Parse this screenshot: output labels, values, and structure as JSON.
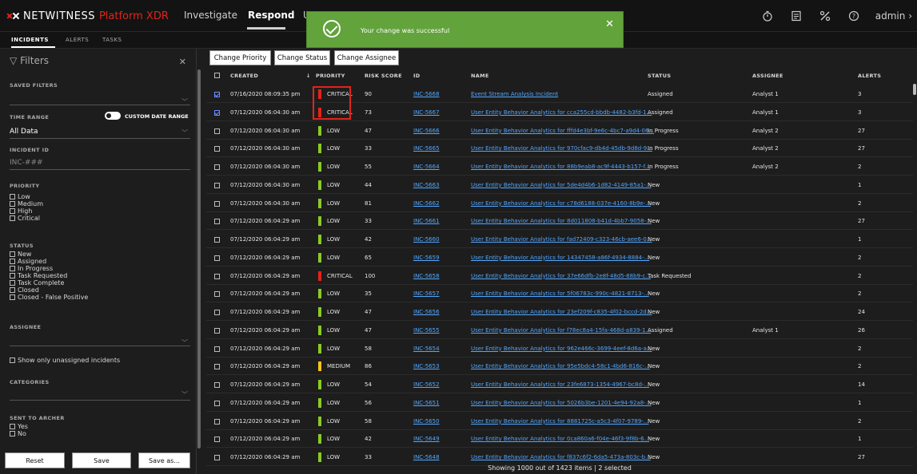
{
  "app": {
    "brand": "NETWITNESS",
    "product": "Platform XDR",
    "nav": [
      {
        "label": "Investigate"
      },
      {
        "label": "Respond"
      },
      {
        "label": "U"
      }
    ],
    "user": "admin",
    "icons": [
      "timer-icon",
      "report-icon",
      "tools-icon",
      "help-icon"
    ]
  },
  "toast": {
    "message": "Your change was successful"
  },
  "subtabs": [
    "INCIDENTS",
    "ALERTS",
    "TASKS"
  ],
  "sidebar": {
    "title": "Filters",
    "saved_filters_label": "SAVED FILTERS",
    "time_range_label": "TIME RANGE",
    "custom_date_range_label": "CUSTOM DATE RANGE",
    "time_range_value": "All Data",
    "incident_id_label": "INCIDENT ID",
    "incident_id_placeholder": "INC-###",
    "priority_label": "PRIORITY",
    "priority_options": [
      "Low",
      "Medium",
      "High",
      "Critical"
    ],
    "status_label": "STATUS",
    "status_options": [
      "New",
      "Assigned",
      "In Progress",
      "Task Requested",
      "Task Complete",
      "Closed",
      "Closed - False Positive"
    ],
    "assignee_label": "ASSIGNEE",
    "unassigned_label": "Show only unassigned incidents",
    "categories_label": "CATEGORIES",
    "archer_label": "SENT TO ARCHER",
    "archer_options": [
      "Yes",
      "No"
    ],
    "buttons": {
      "reset": "Reset",
      "save": "Save",
      "save_as": "Save as..."
    }
  },
  "toolbar": {
    "change_priority": "Change Priority",
    "change_status": "Change Status",
    "change_assignee": "Change Assignee"
  },
  "columns": {
    "created": "CREATED",
    "priority": "PRIORITY",
    "risk_score": "RISK SCORE",
    "id": "ID",
    "name": "NAME",
    "status": "STATUS",
    "assignee": "ASSIGNEE",
    "alerts": "ALERTS",
    "sort_indicator": "↓"
  },
  "priority_colors": {
    "CRITICAL": "#e2241b",
    "LOW": "#8ac926",
    "MEDIUM": "#f5c518"
  },
  "rows": [
    {
      "checked": true,
      "created": "07/16/2020 08:09:35 pm",
      "priority": "CRITICAL",
      "risk": "90",
      "id": "INC-5668",
      "name": "Event Stream Analysis Incident",
      "status": "Assigned",
      "assignee": "Analyst 1",
      "alerts": "3"
    },
    {
      "checked": true,
      "created": "07/12/2020 06:04:30 am",
      "priority": "CRITICAL",
      "risk": "73",
      "id": "INC-5667",
      "name": "User Entity Behavior Analytics for cca255cd-bbdb-4482-b3fd-1...",
      "status": "Assigned",
      "assignee": "Analyst 1",
      "alerts": "3"
    },
    {
      "checked": false,
      "created": "07/12/2020 06:04:30 am",
      "priority": "LOW",
      "risk": "47",
      "id": "INC-5666",
      "name": "User Entity Behavior Analytics for fffd4e3bf-9e6c-4bc7-a9d4-06...",
      "status": "In Progress",
      "assignee": "Analyst 2",
      "alerts": "27"
    },
    {
      "checked": false,
      "created": "07/12/2020 06:04:30 am",
      "priority": "LOW",
      "risk": "33",
      "id": "INC-5665",
      "name": "User Entity Behavior Analytics for 970cfac9-db4d-45db-9d8d-9...",
      "status": "In Progress",
      "assignee": "Analyst 2",
      "alerts": "27"
    },
    {
      "checked": false,
      "created": "07/12/2020 06:04:30 am",
      "priority": "LOW",
      "risk": "55",
      "id": "INC-5664",
      "name": "User Entity Behavior Analytics for 88b9eab8-ac9f-4443-b157-f...",
      "status": "In Progress",
      "assignee": "Analyst 2",
      "alerts": "2"
    },
    {
      "checked": false,
      "created": "07/12/2020 06:04:30 am",
      "priority": "LOW",
      "risk": "44",
      "id": "INC-5663",
      "name": "User Entity Behavior Analytics for 5de4d4b6-1d82-4149-85a1-...",
      "status": "New",
      "assignee": "",
      "alerts": "1"
    },
    {
      "checked": false,
      "created": "07/12/2020 06:04:30 am",
      "priority": "LOW",
      "risk": "81",
      "id": "INC-5662",
      "name": "User Entity Behavior Analytics for c78d6188-037e-4160-8b9e-...",
      "status": "New",
      "assignee": "",
      "alerts": "2"
    },
    {
      "checked": false,
      "created": "07/12/2020 06:04:29 am",
      "priority": "LOW",
      "risk": "33",
      "id": "INC-5661",
      "name": "User Entity Behavior Analytics for 8d011808-b41d-4bb7-9058-...",
      "status": "New",
      "assignee": "",
      "alerts": "27"
    },
    {
      "checked": false,
      "created": "07/12/2020 06:04:29 am",
      "priority": "LOW",
      "risk": "42",
      "id": "INC-5660",
      "name": "User Entity Behavior Analytics for fad72409-c323-46cb-aee6-0...",
      "status": "New",
      "assignee": "",
      "alerts": "1"
    },
    {
      "checked": false,
      "created": "07/12/2020 06:04:29 am",
      "priority": "LOW",
      "risk": "65",
      "id": "INC-5659",
      "name": "User Entity Behavior Analytics for 14347458-a86f-4934-8884-...",
      "status": "New",
      "assignee": "",
      "alerts": "2"
    },
    {
      "checked": false,
      "created": "07/12/2020 06:04:29 am",
      "priority": "CRITICAL",
      "risk": "100",
      "id": "INC-5658",
      "name": "User Entity Behavior Analytics for 37e66dfb-2e8f-48d5-88b9-c...",
      "status": "Task Requested",
      "assignee": "",
      "alerts": "2"
    },
    {
      "checked": false,
      "created": "07/12/2020 06:04:29 am",
      "priority": "LOW",
      "risk": "35",
      "id": "INC-5657",
      "name": "User Entity Behavior Analytics for 5f06783c-990c-4821-8713-...",
      "status": "New",
      "assignee": "",
      "alerts": "2"
    },
    {
      "checked": false,
      "created": "07/12/2020 06:04:29 am",
      "priority": "LOW",
      "risk": "47",
      "id": "INC-5656",
      "name": "User Entity Behavior Analytics for 23ef209f-c835-4f02-bccd-2d...",
      "status": "New",
      "assignee": "",
      "alerts": "24"
    },
    {
      "checked": false,
      "created": "07/12/2020 06:04:29 am",
      "priority": "LOW",
      "risk": "47",
      "id": "INC-5655",
      "name": "User Entity Behavior Analytics for f78ec8a4-15fa-468d-a839-1...",
      "status": "Assigned",
      "assignee": "Analyst 1",
      "alerts": "26"
    },
    {
      "checked": false,
      "created": "07/12/2020 06:04:29 am",
      "priority": "LOW",
      "risk": "58",
      "id": "INC-5654",
      "name": "User Entity Behavior Analytics for 962e466c-3699-4eef-8d6a-a...",
      "status": "New",
      "assignee": "",
      "alerts": "2"
    },
    {
      "checked": false,
      "created": "07/12/2020 06:04:29 am",
      "priority": "MEDIUM",
      "risk": "86",
      "id": "INC-5653",
      "name": "User Entity Behavior Analytics for 95e5bdc4-58c1-4bd6-816c-...",
      "status": "New",
      "assignee": "",
      "alerts": "2"
    },
    {
      "checked": false,
      "created": "07/12/2020 06:04:29 am",
      "priority": "LOW",
      "risk": "54",
      "id": "INC-5652",
      "name": "User Entity Behavior Analytics for 23fe6873-1354-4967-bc8d-...",
      "status": "New",
      "assignee": "",
      "alerts": "14"
    },
    {
      "checked": false,
      "created": "07/12/2020 06:04:29 am",
      "priority": "LOW",
      "risk": "56",
      "id": "INC-5651",
      "name": "User Entity Behavior Analytics for 5026b3be-1201-4e94-92a8-...",
      "status": "New",
      "assignee": "",
      "alerts": "1"
    },
    {
      "checked": false,
      "created": "07/12/2020 06:04:29 am",
      "priority": "LOW",
      "risk": "58",
      "id": "INC-5650",
      "name": "User Entity Behavior Analytics for 8881725c-a5c3-4f07-9789-...",
      "status": "New",
      "assignee": "",
      "alerts": "2"
    },
    {
      "checked": false,
      "created": "07/12/2020 06:04:29 am",
      "priority": "LOW",
      "risk": "42",
      "id": "INC-5649",
      "name": "User Entity Behavior Analytics for 0ca860a6-f04e-46f3-9f8b-6...",
      "status": "New",
      "assignee": "",
      "alerts": "1"
    },
    {
      "checked": false,
      "created": "07/12/2020 06:04:29 am",
      "priority": "LOW",
      "risk": "33",
      "id": "INC-5648",
      "name": "User Entity Behavior Analytics for f837c6f2-6da5-473a-803c-b...",
      "status": "New",
      "assignee": "",
      "alerts": "27"
    }
  ],
  "footer": {
    "text": "Showing 1000 out of 1423 items  |  2 selected"
  }
}
